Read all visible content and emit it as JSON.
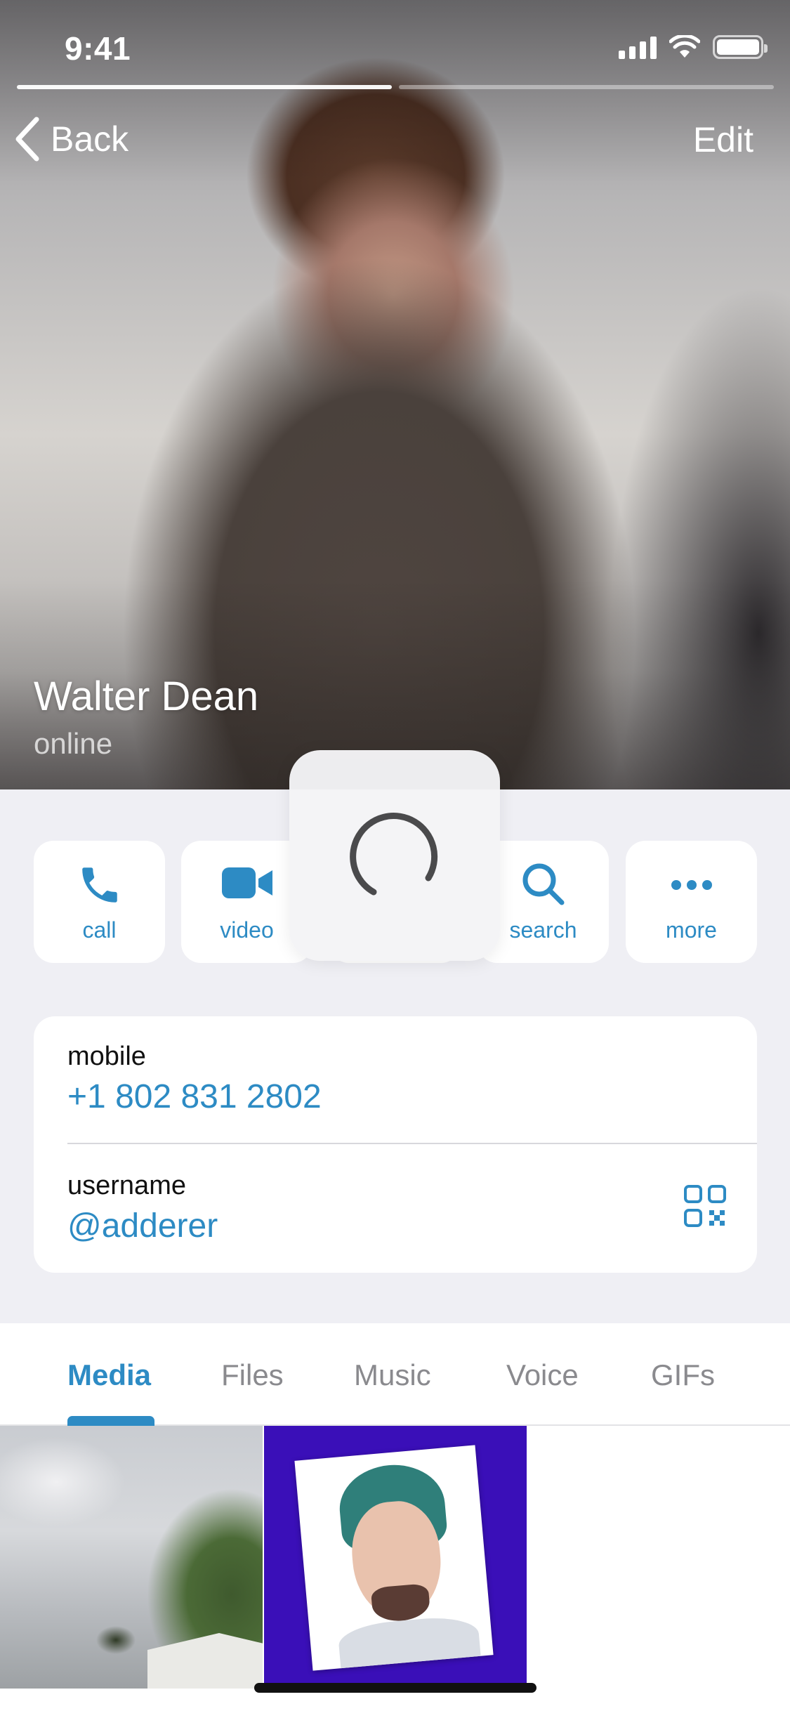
{
  "status_bar": {
    "time": "9:41"
  },
  "nav": {
    "back_label": "Back",
    "edit_label": "Edit"
  },
  "profile": {
    "name": "Walter Dean",
    "status": "online"
  },
  "actions": [
    {
      "label": "call",
      "icon": "phone-icon"
    },
    {
      "label": "video",
      "icon": "video-camera-icon"
    },
    {
      "label": "",
      "icon": "mute-icon"
    },
    {
      "label": "search",
      "icon": "search-icon"
    },
    {
      "label": "more",
      "icon": "more-dots-icon"
    }
  ],
  "info": {
    "mobile_label": "mobile",
    "mobile_value": "+1 802 831 2802",
    "username_label": "username",
    "username_value": "@adderer"
  },
  "tabs": [
    "Media",
    "Files",
    "Music",
    "Voice",
    "GIFs"
  ],
  "active_tab": "Media",
  "colors": {
    "accent": "#2d8bc4",
    "background": "#efeff4",
    "card": "#ffffff"
  },
  "story_progress": {
    "segments": 2,
    "current": 1
  }
}
